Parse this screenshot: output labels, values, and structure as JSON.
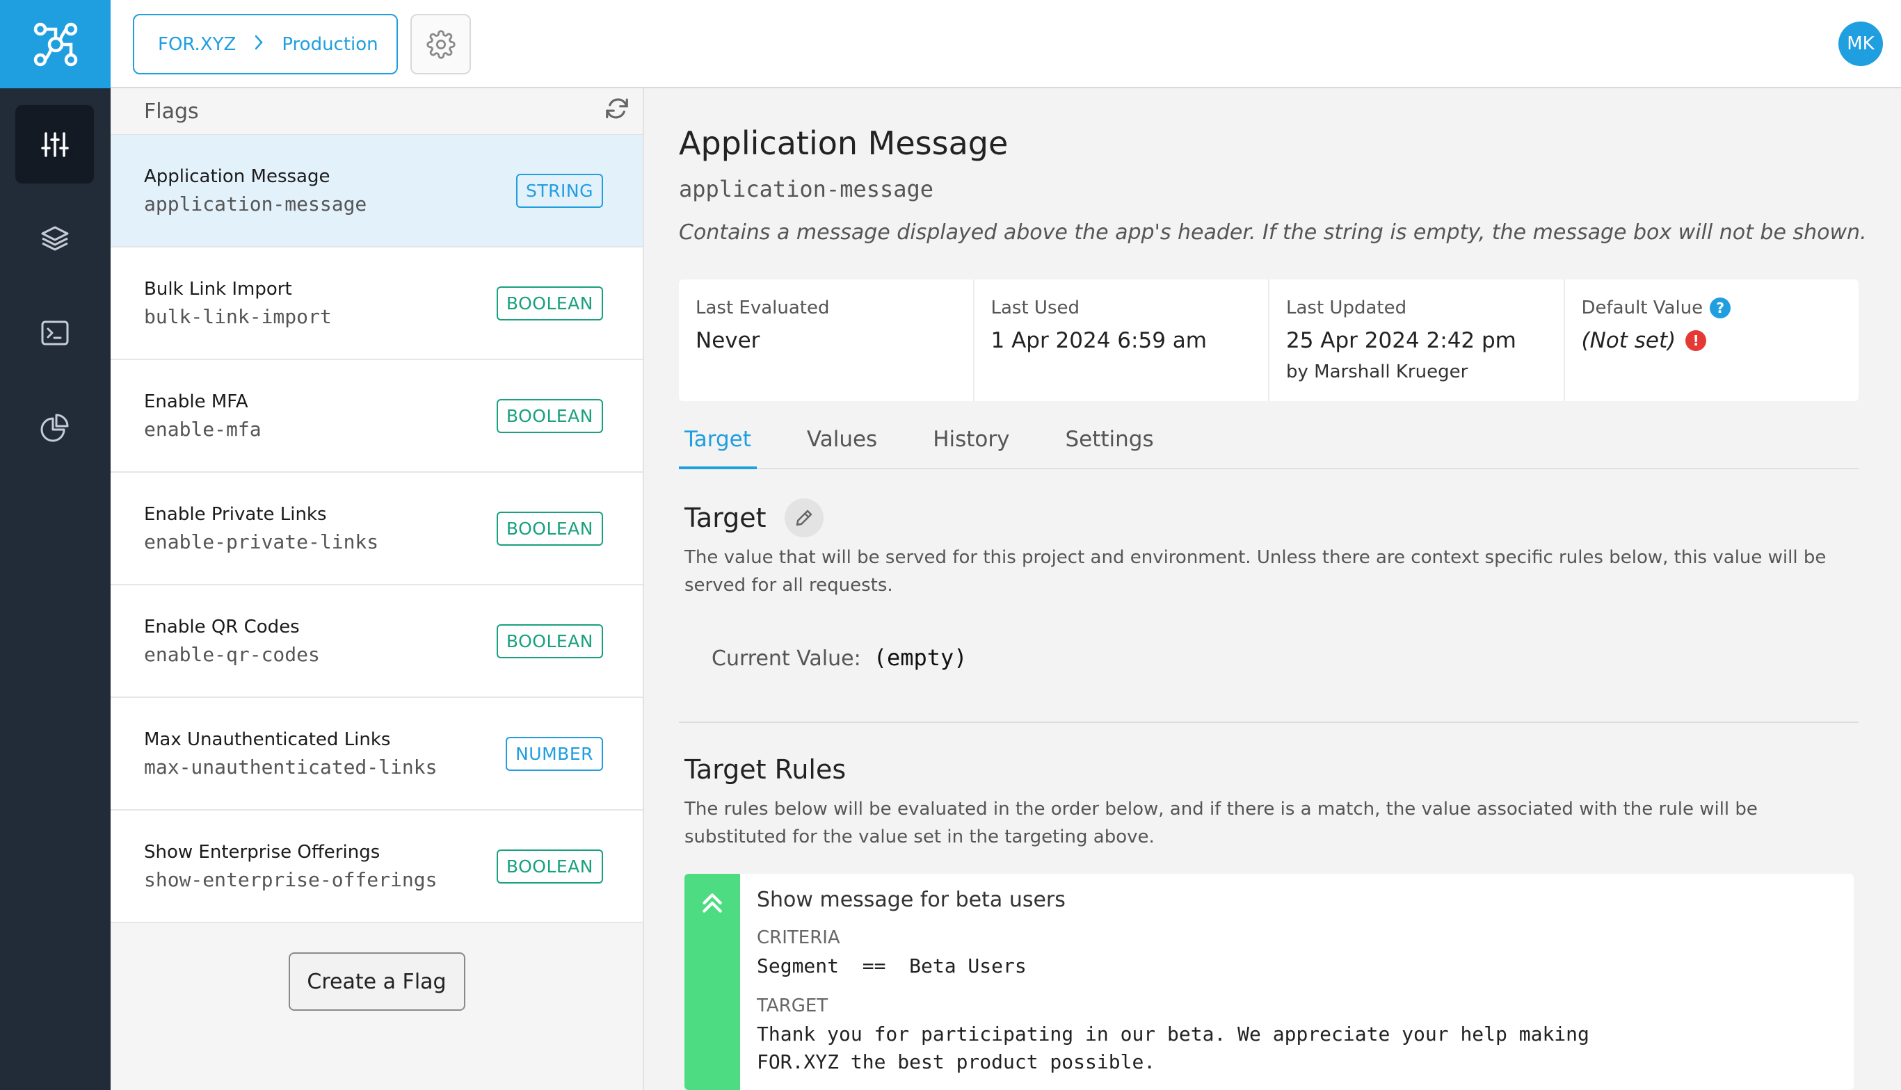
{
  "header": {
    "breadcrumb_project": "FOR.XYZ",
    "breadcrumb_sep": ">",
    "breadcrumb_env": "Production",
    "avatar_initials": "MK"
  },
  "sidebar": {
    "items": [
      {
        "icon": "sliders-icon",
        "active": true
      },
      {
        "icon": "layers-icon",
        "active": false
      },
      {
        "icon": "terminal-icon",
        "active": false
      },
      {
        "icon": "pie-chart-icon",
        "active": false
      }
    ]
  },
  "flags_panel": {
    "title": "Flags",
    "flags": [
      {
        "name": "Application Message",
        "key": "application-message",
        "type": "STRING"
      },
      {
        "name": "Bulk Link Import",
        "key": "bulk-link-import",
        "type": "BOOLEAN"
      },
      {
        "name": "Enable MFA",
        "key": "enable-mfa",
        "type": "BOOLEAN"
      },
      {
        "name": "Enable Private Links",
        "key": "enable-private-links",
        "type": "BOOLEAN"
      },
      {
        "name": "Enable QR Codes",
        "key": "enable-qr-codes",
        "type": "BOOLEAN"
      },
      {
        "name": "Max Unauthenticated Links",
        "key": "max-unauthenticated-links",
        "type": "NUMBER"
      },
      {
        "name": "Show Enterprise Offerings",
        "key": "show-enterprise-offerings",
        "type": "BOOLEAN"
      }
    ],
    "create_label": "Create a Flag"
  },
  "detail": {
    "title": "Application Message",
    "key": "application-message",
    "description": "Contains a message displayed above the app's header. If the string is empty, the message box will not be shown.",
    "stats": {
      "last_evaluated_label": "Last Evaluated",
      "last_evaluated_value": "Never",
      "last_used_label": "Last Used",
      "last_used_value": "1 Apr 2024 6:59 am",
      "last_updated_label": "Last Updated",
      "last_updated_value": "25 Apr 2024 2:42 pm",
      "last_updated_by": "by Marshall Krueger",
      "default_value_label": "Default Value",
      "default_value_help": "?",
      "default_value_value": "(Not set)",
      "default_value_warn": "!"
    },
    "tabs": [
      "Target",
      "Values",
      "History",
      "Settings"
    ],
    "target": {
      "title": "Target",
      "description": "The value that will be served for this project and environment. Unless there are context specific rules below, this value will be served for all requests.",
      "current_value_label": "Current Value:",
      "current_value": "(empty)"
    },
    "target_rules": {
      "title": "Target Rules",
      "description": "The rules below will be evaluated in the order below, and if there is a match, the value associated with the rule will be substituted for the value set in the targeting above.",
      "rule": {
        "name": "Show message for beta users",
        "criteria_label": "CRITERIA",
        "criteria": "Segment  ==  Beta Users",
        "target_label": "TARGET",
        "target": "Thank you for participating in our beta. We appreciate your help making\nFOR.XYZ the best product possible."
      }
    }
  },
  "colors": {
    "accent": "#1f9ee0",
    "rail": "#222b38",
    "boolean_badge": "#18a07f",
    "rule_bar": "#4ddc82"
  }
}
